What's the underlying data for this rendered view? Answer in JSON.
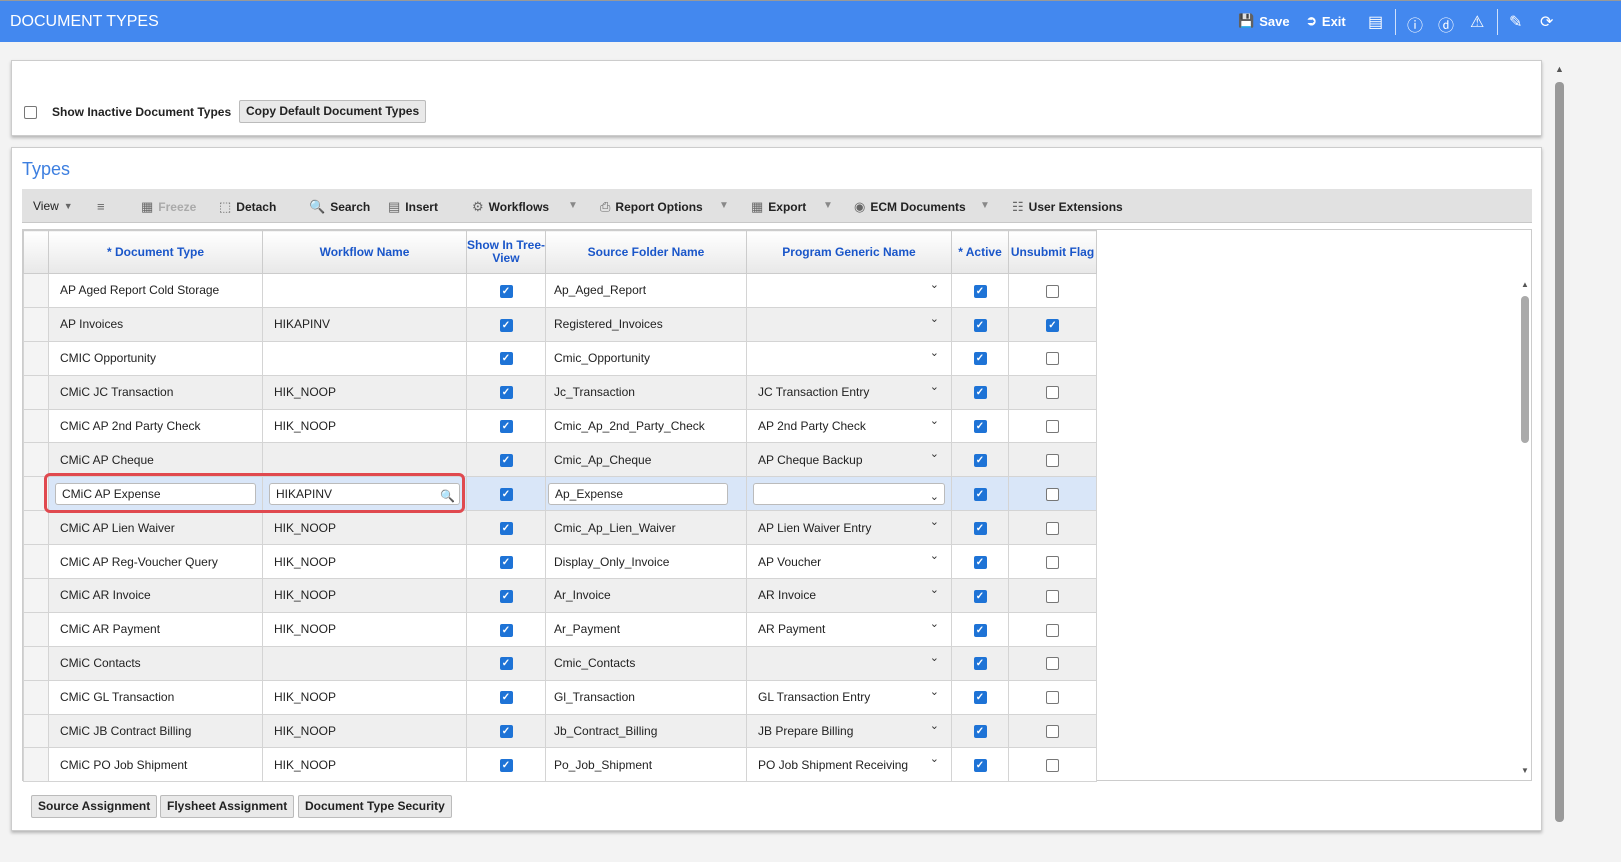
{
  "header": {
    "title": "DOCUMENT TYPES",
    "save": "Save",
    "exit": "Exit",
    "icons": [
      "save-icon",
      "exit-icon",
      "windows-icon",
      "info-icon",
      "help-icon",
      "warning-icon",
      "edit-icon",
      "refresh-icon"
    ]
  },
  "filters": {
    "show_inactive_label": "Show Inactive Document Types",
    "show_inactive_checked": false,
    "copy_default": "Copy Default Document Types"
  },
  "types": {
    "title": "Types",
    "toolbar": {
      "view": "View",
      "freeze": "Freeze",
      "detach": "Detach",
      "search": "Search",
      "insert": "Insert",
      "workflows": "Workflows",
      "report_options": "Report Options",
      "export": "Export",
      "ecm_documents": "ECM Documents",
      "user_extensions": "User Extensions"
    },
    "columns": [
      "* Document Type",
      "Workflow Name",
      "Show In Tree-View",
      "Source Folder Name",
      "Program Generic Name",
      "* Active",
      "Unsubmit Flag"
    ],
    "rows": [
      {
        "doc": "AP Aged Report Cold Storage",
        "wf": "",
        "tree": true,
        "folder": "Ap_Aged_Report",
        "prog": "",
        "active": true,
        "unsubmit": false
      },
      {
        "doc": "AP Invoices",
        "wf": "HIKAPINV",
        "tree": true,
        "folder": "Registered_Invoices",
        "prog": "",
        "active": true,
        "unsubmit": true
      },
      {
        "doc": "CMIC Opportunity",
        "wf": "",
        "tree": true,
        "folder": "Cmic_Opportunity",
        "prog": "",
        "active": true,
        "unsubmit": false
      },
      {
        "doc": "CMiC  JC Transaction",
        "wf": "HIK_NOOP",
        "tree": true,
        "folder": "Jc_Transaction",
        "prog": "JC Transaction Entry",
        "active": true,
        "unsubmit": false
      },
      {
        "doc": "CMiC AP 2nd Party Check",
        "wf": "HIK_NOOP",
        "tree": true,
        "folder": "Cmic_Ap_2nd_Party_Check",
        "prog": "AP 2nd Party Check",
        "active": true,
        "unsubmit": false
      },
      {
        "doc": "CMiC AP Cheque",
        "wf": "",
        "tree": true,
        "folder": "Cmic_Ap_Cheque",
        "prog": "AP Cheque Backup",
        "active": true,
        "unsubmit": false
      },
      {
        "doc": "CMiC AP Expense",
        "wf": "HIKAPINV",
        "tree": true,
        "folder": "Ap_Expense",
        "prog": "",
        "active": true,
        "unsubmit": false,
        "editing": true
      },
      {
        "doc": "CMiC AP Lien Waiver",
        "wf": "HIK_NOOP",
        "tree": true,
        "folder": "Cmic_Ap_Lien_Waiver",
        "prog": "AP Lien Waiver Entry",
        "active": true,
        "unsubmit": false
      },
      {
        "doc": "CMiC AP Reg-Voucher Query",
        "wf": "HIK_NOOP",
        "tree": true,
        "folder": "Display_Only_Invoice",
        "prog": "AP Voucher",
        "active": true,
        "unsubmit": false
      },
      {
        "doc": "CMiC AR Invoice",
        "wf": "HIK_NOOP",
        "tree": true,
        "folder": "Ar_Invoice",
        "prog": "AR Invoice",
        "active": true,
        "unsubmit": false
      },
      {
        "doc": "CMiC AR Payment",
        "wf": "HIK_NOOP",
        "tree": true,
        "folder": "Ar_Payment",
        "prog": "AR Payment",
        "active": true,
        "unsubmit": false
      },
      {
        "doc": "CMiC Contacts",
        "wf": "",
        "tree": true,
        "folder": "Cmic_Contacts",
        "prog": "",
        "active": true,
        "unsubmit": false
      },
      {
        "doc": "CMiC GL Transaction",
        "wf": "HIK_NOOP",
        "tree": true,
        "folder": "Gl_Transaction",
        "prog": "GL Transaction Entry",
        "active": true,
        "unsubmit": false
      },
      {
        "doc": "CMiC JB Contract Billing",
        "wf": "HIK_NOOP",
        "tree": true,
        "folder": "Jb_Contract_Billing",
        "prog": "JB Prepare Billing",
        "active": true,
        "unsubmit": false
      },
      {
        "doc": "CMiC PO Job Shipment",
        "wf": "HIK_NOOP",
        "tree": true,
        "folder": "Po_Job_Shipment",
        "prog": "PO Job Shipment Receiving",
        "active": true,
        "unsubmit": false
      }
    ]
  },
  "footer": {
    "source_assignment": "Source Assignment",
    "flysheet_assignment": "Flysheet Assignment",
    "document_type_security": "Document Type Security"
  }
}
